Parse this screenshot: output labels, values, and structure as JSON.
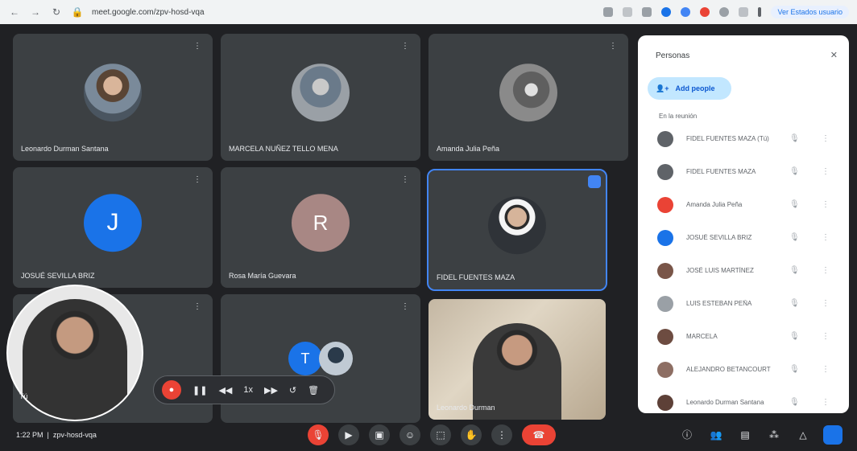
{
  "browser": {
    "url": "meet.google.com/zpv-hosd-vqa",
    "profile": "Ver Estados usuario"
  },
  "tiles": [
    {
      "name": "Leonardo Durman Santana"
    },
    {
      "name": "MARCELA NUÑEZ TELLO MENA"
    },
    {
      "name": "Amanda Julia Peña"
    },
    {
      "name": "JOSUÉ SEVILLA BRIZ",
      "initial": "J"
    },
    {
      "name": "Rosa María Guevara",
      "initial": "R"
    },
    {
      "name": "FIDEL FUENTES MAZA"
    },
    {
      "name": ""
    },
    {
      "name": "",
      "initial": "T"
    },
    {
      "name": "Leonardo Durman"
    }
  ],
  "self_view": {
    "label": "Tú"
  },
  "recording": {
    "icons": [
      "record-icon",
      "pause-icon",
      "rewind-icon",
      "speed-icon",
      "forward-icon",
      "undo-icon",
      "delete-icon"
    ],
    "speed": "1x"
  },
  "toolbar": {
    "time": "1:22 PM",
    "meeting_code": "zpv-hosd-vqa",
    "center_icons": [
      "mic-off-icon",
      "camera-icon",
      "captions-icon",
      "emoji-icon",
      "present-icon",
      "hand-icon",
      "more-icon",
      "end-call-icon"
    ],
    "right_icons": [
      "info-icon",
      "people-icon",
      "chat-icon",
      "activities-icon",
      "host-controls-icon",
      "panel-toggle-icon"
    ]
  },
  "people_panel": {
    "title": "Personas",
    "add_label": "Add people",
    "section": "En la reunión",
    "participants": [
      {
        "name": "FIDEL FUENTES MAZA (Tú)",
        "avatar_color": "#5f6368"
      },
      {
        "name": "FIDEL FUENTES MAZA",
        "avatar_color": "#5f6368"
      },
      {
        "name": "Amanda Julia Peña",
        "avatar_color": "#ea4335"
      },
      {
        "name": "JOSUÉ SEVILLA BRIZ",
        "avatar_color": "#1a73e8"
      },
      {
        "name": "JOSÉ LUIS MARTÍNEZ",
        "avatar_color": "#795548"
      },
      {
        "name": "LUIS ESTEBAN PEÑA",
        "avatar_color": "#9aa0a6"
      },
      {
        "name": "MARCELA",
        "avatar_color": "#6d4c41"
      },
      {
        "name": "ALEJANDRO BETANCOURT",
        "avatar_color": "#8d6e63"
      },
      {
        "name": "Leonardo Durman Santana",
        "avatar_color": "#5d4037"
      }
    ]
  },
  "colors": {
    "background": "#202124",
    "tile": "#3c4043",
    "accent": "#1a73e8",
    "end_call": "#ea4335"
  }
}
